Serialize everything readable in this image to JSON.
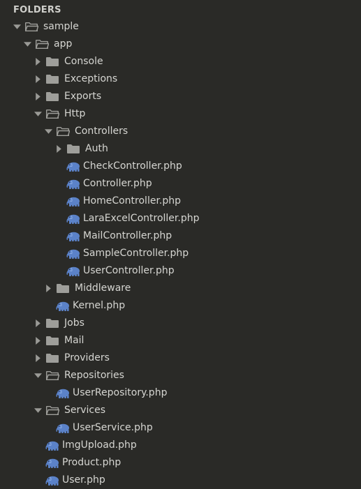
{
  "sidebar": {
    "header": "FOLDERS",
    "colors": {
      "background": "#2a2a27",
      "text": "#d6d6d2",
      "folder": "#9e9e9a",
      "arrow": "#9a9a96",
      "php_icon": "#5b82c8"
    },
    "tree": [
      {
        "label": "sample",
        "type": "folder",
        "depth": 0,
        "expanded": true
      },
      {
        "label": "app",
        "type": "folder",
        "depth": 1,
        "expanded": true
      },
      {
        "label": "Console",
        "type": "folder",
        "depth": 2,
        "expanded": false
      },
      {
        "label": "Exceptions",
        "type": "folder",
        "depth": 2,
        "expanded": false
      },
      {
        "label": "Exports",
        "type": "folder",
        "depth": 2,
        "expanded": false
      },
      {
        "label": "Http",
        "type": "folder",
        "depth": 2,
        "expanded": true
      },
      {
        "label": "Controllers",
        "type": "folder",
        "depth": 3,
        "expanded": true
      },
      {
        "label": "Auth",
        "type": "folder",
        "depth": 4,
        "expanded": false
      },
      {
        "label": "CheckController.php",
        "type": "php",
        "depth": 4
      },
      {
        "label": "Controller.php",
        "type": "php",
        "depth": 4
      },
      {
        "label": "HomeController.php",
        "type": "php",
        "depth": 4
      },
      {
        "label": "LaraExcelController.php",
        "type": "php",
        "depth": 4
      },
      {
        "label": "MailController.php",
        "type": "php",
        "depth": 4
      },
      {
        "label": "SampleController.php",
        "type": "php",
        "depth": 4
      },
      {
        "label": "UserController.php",
        "type": "php",
        "depth": 4
      },
      {
        "label": "Middleware",
        "type": "folder",
        "depth": 3,
        "expanded": false
      },
      {
        "label": "Kernel.php",
        "type": "php",
        "depth": 3
      },
      {
        "label": "Jobs",
        "type": "folder",
        "depth": 2,
        "expanded": false
      },
      {
        "label": "Mail",
        "type": "folder",
        "depth": 2,
        "expanded": false
      },
      {
        "label": "Providers",
        "type": "folder",
        "depth": 2,
        "expanded": false
      },
      {
        "label": "Repositories",
        "type": "folder",
        "depth": 2,
        "expanded": true
      },
      {
        "label": "UserRepository.php",
        "type": "php",
        "depth": 3
      },
      {
        "label": "Services",
        "type": "folder",
        "depth": 2,
        "expanded": true
      },
      {
        "label": "UserService.php",
        "type": "php",
        "depth": 3
      },
      {
        "label": "ImgUpload.php",
        "type": "php",
        "depth": 2
      },
      {
        "label": "Product.php",
        "type": "php",
        "depth": 2
      },
      {
        "label": "User.php",
        "type": "php",
        "depth": 2
      }
    ]
  }
}
